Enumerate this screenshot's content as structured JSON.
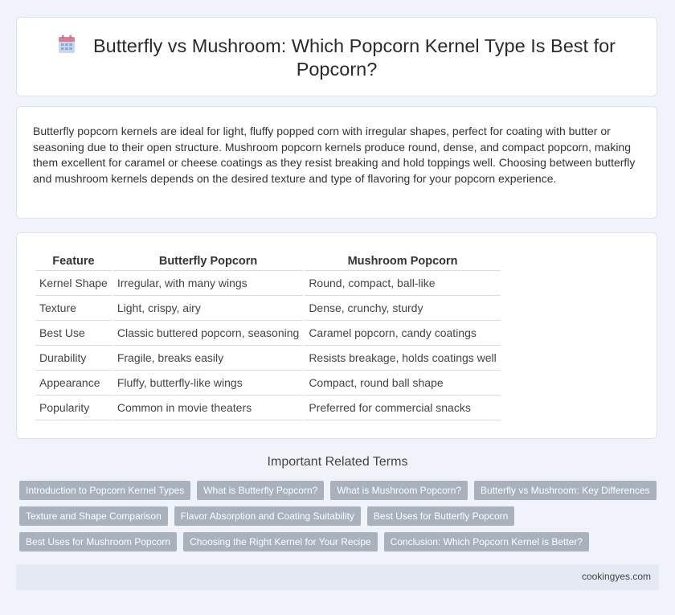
{
  "header": {
    "title": "Butterfly vs Mushroom: Which Popcorn Kernel Type Is Best for Popcorn?",
    "icon": "calendar-icon"
  },
  "intro": {
    "text": "Butterfly popcorn kernels are ideal for light, fluffy popped corn with irregular shapes, perfect for coating with butter or seasoning due to their open structure. Mushroom popcorn kernels produce round, dense, and compact popcorn, making them excellent for caramel or cheese coatings as they resist breaking and hold toppings well. Choosing between butterfly and mushroom kernels depends on the desired texture and type of flavoring for your popcorn experience."
  },
  "table": {
    "headers": [
      "Feature",
      "Butterfly Popcorn",
      "Mushroom Popcorn"
    ],
    "rows": [
      [
        "Kernel Shape",
        "Irregular, with many wings",
        "Round, compact, ball-like"
      ],
      [
        "Texture",
        "Light, crispy, airy",
        "Dense, crunchy, sturdy"
      ],
      [
        "Best Use",
        "Classic buttered popcorn, seasoning",
        "Caramel popcorn, candy coatings"
      ],
      [
        "Durability",
        "Fragile, breaks easily",
        "Resists breakage, holds coatings well"
      ],
      [
        "Appearance",
        "Fluffy, butterfly-like wings",
        "Compact, round ball shape"
      ],
      [
        "Popularity",
        "Common in movie theaters",
        "Preferred for commercial snacks"
      ]
    ]
  },
  "related": {
    "title": "Important Related Terms",
    "tags": [
      [
        "Introduction to Popcorn Kernel Types",
        "What is Butterfly Popcorn?",
        "What is Mushroom Popcorn?",
        "Butterfly vs Mushroom: Key Differences"
      ],
      [
        "Texture and Shape Comparison",
        "Flavor Absorption and Coating Suitability",
        "Best Uses for Butterfly Popcorn"
      ],
      [
        "Best Uses for Mushroom Popcorn",
        "Choosing the Right Kernel for Your Recipe",
        "Conclusion: Which Popcorn Kernel is Better?"
      ]
    ]
  },
  "footer": {
    "site": "cookingyes.com"
  },
  "colors": {
    "background": "#f0f3f9",
    "tag_background": "#a9b1bd",
    "footer_background": "#e4e9f3",
    "icon_accent": "#e77a8a",
    "icon_body": "#8aa5d8"
  }
}
